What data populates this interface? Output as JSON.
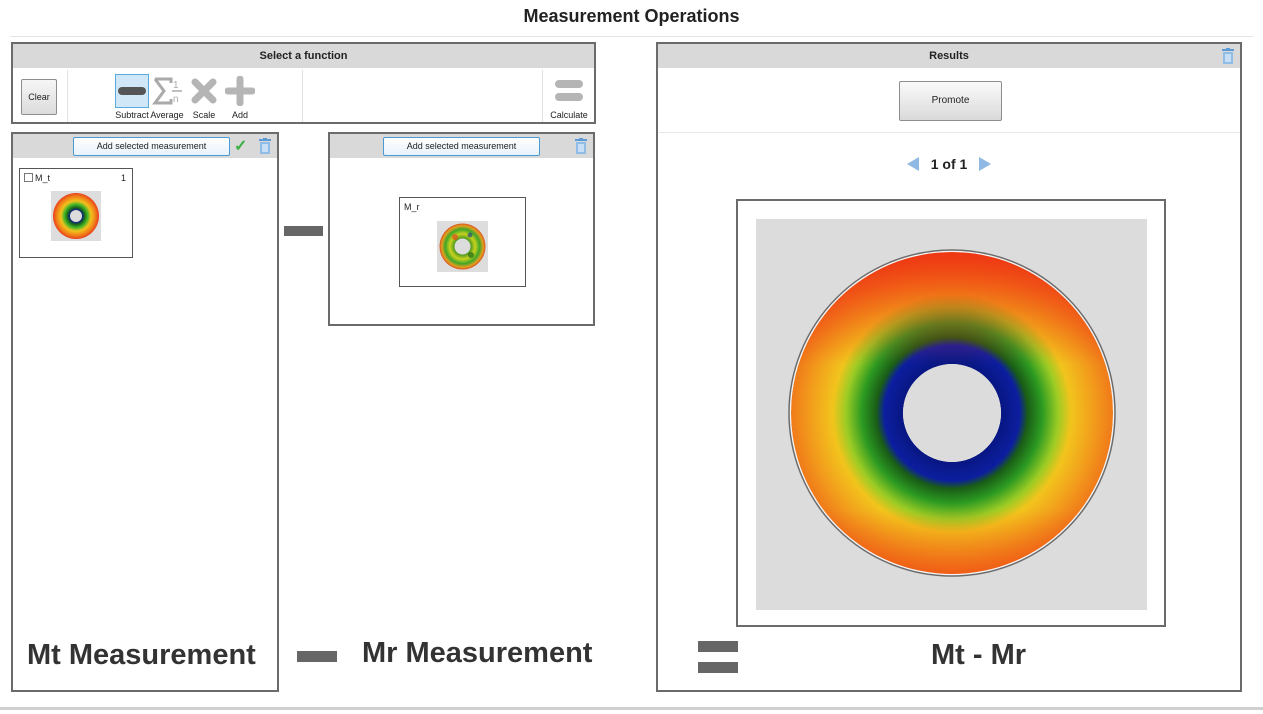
{
  "page": {
    "title": "Measurement Operations"
  },
  "function_panel": {
    "header": "Select a function",
    "clear_label": "Clear",
    "functions": [
      {
        "label": "Subtract",
        "icon": "minus-icon",
        "selected": true
      },
      {
        "label": "Average",
        "icon": "sigma-average-icon",
        "selected": false
      },
      {
        "label": "Scale",
        "icon": "multiply-icon",
        "selected": false
      },
      {
        "label": "Add",
        "icon": "plus-icon",
        "selected": false
      }
    ],
    "calculate_label": "Calculate"
  },
  "mt_box": {
    "add_button": "Add selected measurement",
    "item": {
      "name": "M_t",
      "count": "1"
    },
    "caption": "Mt Measurement"
  },
  "mr_box": {
    "add_button": "Add selected measurement",
    "item": {
      "name": "M_r"
    },
    "caption": "Mr Measurement"
  },
  "results": {
    "header": "Results",
    "promote_label": "Promote",
    "pager": {
      "current": "1",
      "of_label": "of",
      "total": "1"
    },
    "caption": "Mt - Mr"
  },
  "colors": {
    "accent": "#5aa9de",
    "check": "#3cb043",
    "header_bg": "#d9d9d9",
    "operator_gray": "#666666"
  }
}
